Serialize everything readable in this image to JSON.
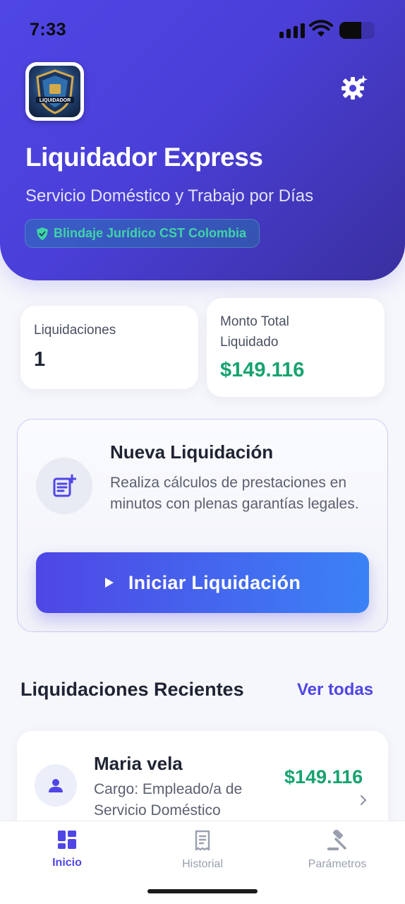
{
  "status_bar": {
    "time": "7:33"
  },
  "header": {
    "logo_text": "LIQUIDADOR",
    "title": "Liquidador Express",
    "subtitle": "Servicio Doméstico y Trabajo por Días",
    "badge": "Blindaje Jurídico CST Colombia",
    "settings_icon": "gear-sparkle-icon"
  },
  "stats": {
    "count_label": "Liquidaciones",
    "count_value": "1",
    "total_label": "Monto Total Liquidado",
    "total_value": "$149.116"
  },
  "new_liquidation": {
    "title": "Nueva Liquidación",
    "description": "Realiza cálculos de prestaciones en minutos con plenas garantías legales.",
    "button_label": "Iniciar Liquidación",
    "icon": "note-add-icon"
  },
  "recent": {
    "title": "Liquidaciones Recientes",
    "see_all": "Ver todas",
    "items": [
      {
        "name": "Maria vela",
        "role": "Cargo: Empleado/a de Servicio Doméstico",
        "amount": "$149.116"
      }
    ]
  },
  "tabs": [
    {
      "label": "Inicio",
      "icon": "dashboard-icon",
      "active": true
    },
    {
      "label": "Historial",
      "icon": "receipt-icon",
      "active": false
    },
    {
      "label": "Parámetros",
      "icon": "gavel-icon",
      "active": false
    }
  ],
  "colors": {
    "primary": "#4f46e5",
    "accent_green": "#16a36e",
    "badge_text": "#3fd4a8"
  }
}
